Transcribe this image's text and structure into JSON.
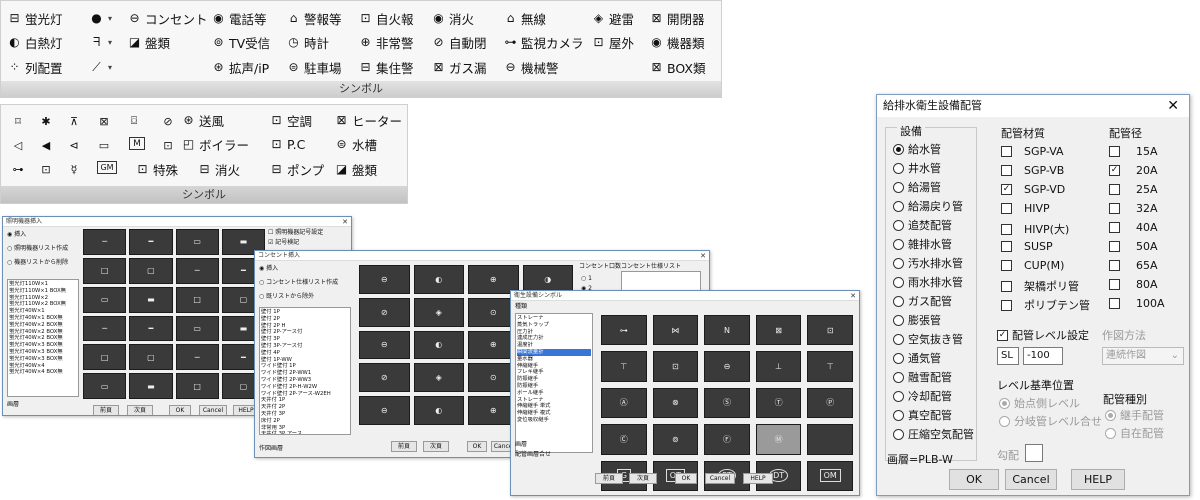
{
  "ribbon1": {
    "caption": "シンボル",
    "items": [
      {
        "label": "蛍光灯",
        "icon": "fluorescent-icon"
      },
      {
        "label": "白熱灯",
        "icon": "incandescent-icon"
      },
      {
        "label": "列配置",
        "icon": "array-icon"
      },
      {
        "label": "コンセント",
        "icon": "outlet-icon"
      },
      {
        "label": "盤類",
        "icon": "panel-icon"
      },
      {
        "label": "電話等",
        "icon": "phone-icon"
      },
      {
        "label": "TV受信",
        "icon": "tv-icon"
      },
      {
        "label": "拡声/iP",
        "icon": "speaker-icon"
      },
      {
        "label": "警報等",
        "icon": "alarm-icon"
      },
      {
        "label": "時計",
        "icon": "clock-icon"
      },
      {
        "label": "駐車場",
        "icon": "parking-icon"
      },
      {
        "label": "自火報",
        "icon": "fire-alarm-icon"
      },
      {
        "label": "非常警",
        "icon": "emergency-icon"
      },
      {
        "label": "集住警",
        "icon": "housing-alarm-icon"
      },
      {
        "label": "消火",
        "icon": "fire-extinguish-icon"
      },
      {
        "label": "自動閉",
        "icon": "auto-close-icon"
      },
      {
        "label": "ガス漏",
        "icon": "gas-leak-icon"
      },
      {
        "label": "無線",
        "icon": "wireless-icon"
      },
      {
        "label": "監視カメラ",
        "icon": "camera-icon"
      },
      {
        "label": "機械警",
        "icon": "machine-alarm-icon"
      },
      {
        "label": "避雷",
        "icon": "lightning-icon"
      },
      {
        "label": "屋外",
        "icon": "outdoor-icon"
      },
      {
        "label": "開閉器",
        "icon": "switch-icon"
      },
      {
        "label": "機器類",
        "icon": "equipment-icon"
      },
      {
        "label": "BOX類",
        "icon": "box-icon"
      }
    ]
  },
  "ribbon2": {
    "caption": "シンボル",
    "items": [
      {
        "label": "送風"
      },
      {
        "label": "ボイラー"
      },
      {
        "label": "特殊"
      },
      {
        "label": "消火"
      },
      {
        "label": "空調"
      },
      {
        "label": "P.C"
      },
      {
        "label": "ポンプ"
      },
      {
        "label": "ヒーター"
      },
      {
        "label": "水槽"
      },
      {
        "label": "盤類"
      }
    ]
  },
  "dialog1": {
    "title": "照明機器挿入",
    "radios": [
      "挿入",
      "照明機器リスト作成",
      "機器リストから削除"
    ],
    "checks": [
      "照明機器記号設定",
      "記号検記"
    ],
    "list": [
      "蛍光灯110W×1",
      "蛍光灯110W×1 BOX無",
      "蛍光灯110W×2",
      "蛍光灯110W×2 BOX無",
      "蛍光灯40W×1",
      "蛍光灯40W×1 BOX無",
      "蛍光灯40W×2 BOX無",
      "蛍光灯40W×2 BOX無",
      "蛍光灯40W×2 BOX無",
      "蛍光灯40W×3 BOX無",
      "蛍光灯40W×3 BOX無",
      "蛍光灯40W×3 BOX無",
      "蛍光灯40W×4",
      "蛍光灯40W×4 BOX無"
    ],
    "layer_label": "画層",
    "buttons": [
      "前頁",
      "次頁",
      "OK",
      "Cancel",
      "HELP"
    ]
  },
  "dialog2": {
    "title": "コンセント挿入",
    "radios": [
      "挿入",
      "コンセント仕様リスト作成",
      "既リストから除外"
    ],
    "list": [
      "壁付 1P",
      "壁付 2P",
      "壁付 2P H",
      "壁付 2P-アース付",
      "壁付 3P",
      "壁付 3P-アース付",
      "壁付 4P",
      "壁付 1P-WW",
      "ワイド壁付 1P",
      "ワイド壁付 2P-WW1",
      "ワイド壁付 2P-WW3",
      "ワイド壁付 2P-H-W2W",
      "ワイド壁付 2P-アース-W2EH",
      "天井付 1P",
      "天井付 2P",
      "天井付 3P",
      "床付 2P",
      "非常用 3P",
      "天井付 3P アース"
    ],
    "outlet_count_label": "コンセント口数",
    "spec_list_label": "コンセント仕様リスト",
    "counts": [
      "1",
      "2"
    ],
    "layer_label": "作図画層",
    "buttons": [
      "前頁",
      "次頁",
      "OK",
      "Cancel",
      "HELP"
    ]
  },
  "dialog3": {
    "title": "衛生設備シンボル",
    "category_label": "種類",
    "list": [
      "ストレーナ",
      "蒸気トラップ",
      "圧力計",
      "連成圧力計",
      "温度計",
      "瞬間流量計",
      "量水器",
      "伸縮継手",
      "フレキ継手",
      "防振継手",
      "防振継手",
      "ボール継手",
      "ストレーナ",
      "伸縮継手 単式",
      "伸縮継手 複式",
      "変位吸収継手"
    ],
    "selected_index": 5,
    "symbols": [
      "G",
      "OT",
      "PT",
      "DT",
      "OM"
    ],
    "layer_label": "画層",
    "pipe_layer_label": "配管画層合せ",
    "buttons": [
      "前頁",
      "次頁",
      "OK",
      "Cancel",
      "HELP"
    ]
  },
  "dialog4": {
    "title": "給排水衛生設備配管",
    "equipment_label": "設備",
    "equipment": [
      "給水管",
      "井水管",
      "給湯管",
      "給湯戻り管",
      "追焚配管",
      "雑排水管",
      "汚水排水管",
      "雨水排水管",
      "ガス配管",
      "膨張管",
      "空気抜き管",
      "通気管",
      "融雪配管",
      "冷却配管",
      "真空配管",
      "圧縮空気配管"
    ],
    "equipment_selected": 0,
    "material_label": "配管材質",
    "materials": [
      "SGP-VA",
      "SGP-VB",
      "SGP-VD",
      "HIVP",
      "HIVP(大)",
      "SUSP",
      "CUP(M)",
      "架橋ポリ管",
      "ポリブテン管"
    ],
    "materials_checked": [
      2
    ],
    "diameter_label": "配管径",
    "diameters": [
      "15A",
      "20A",
      "25A",
      "32A",
      "40A",
      "50A",
      "65A",
      "80A",
      "100A"
    ],
    "diameters_checked": [
      1
    ],
    "level_check_label": "配管レベル設定",
    "level_code": "SL",
    "level_value": "-100",
    "draw_method_label": "作図方法",
    "draw_method_value": "連続作図",
    "ref_label": "レベル基準位置",
    "ref_options": [
      "始点側レベル",
      "分岐管レベル合せ"
    ],
    "type_label": "配管種別",
    "type_options": [
      "継手配管",
      "自在配管"
    ],
    "slope_label": "勾配",
    "layer_text": "画層=PLB-W",
    "buttons": [
      "OK",
      "Cancel",
      "HELP"
    ]
  }
}
